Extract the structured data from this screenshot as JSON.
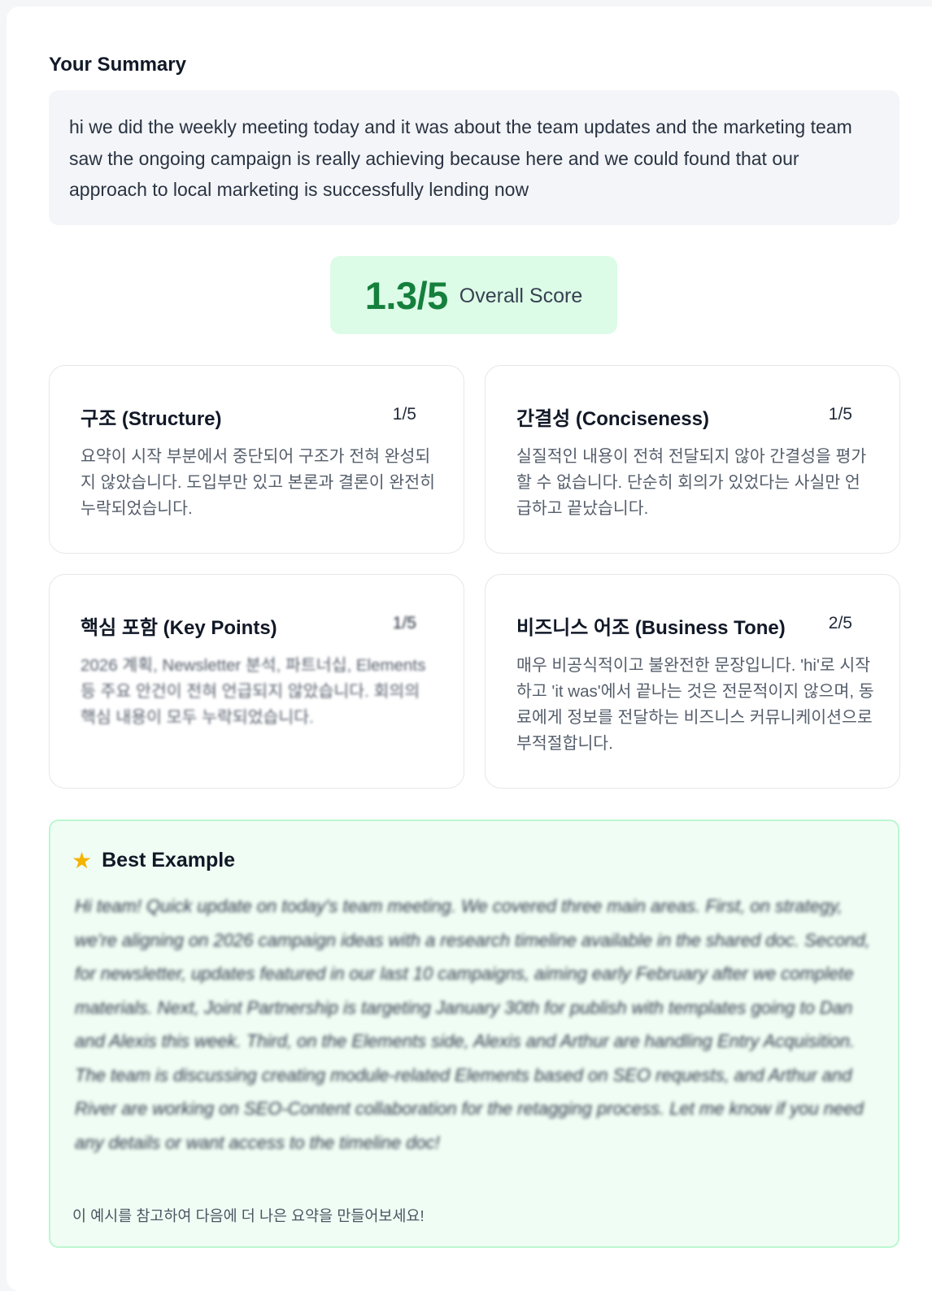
{
  "summary": {
    "label": "Your Summary",
    "text": "hi we did the weekly meeting today and it was  about the team updates and the marketing team saw the ongoing campaign is really achieving because here and we could found that our approach to local marketing is successfully lending now"
  },
  "score": {
    "value": "1.3/5",
    "label": "Overall Score"
  },
  "criteria": [
    {
      "title": "구조 (Structure)",
      "score": "1/5",
      "feedback": "요약이 시작 부분에서 중단되어 구조가 전혀 완성되지 않았습니다. 도입부만 있고 본론과 결론이 완전히 누락되었습니다."
    },
    {
      "title": "간결성 (Conciseness)",
      "score": "1/5",
      "feedback": "실질적인 내용이 전혀 전달되지 않아 간결성을 평가할 수 없습니다. 단순히 회의가 있었다는 사실만 언급하고 끝났습니다."
    },
    {
      "title": "핵심 포함 (Key Points)",
      "score": "1/5",
      "feedback": "2026 계획, Newsletter 분석, 파트너십, Elements 등 주요 안건이 전혀 언급되지 않았습니다. 회의의 핵심 내용이 모두 누락되었습니다."
    },
    {
      "title": "비즈니스 어조 (Business Tone)",
      "score": "2/5",
      "feedback": "매우 비공식적이고 불완전한 문장입니다. 'hi'로 시작하고 'it was'에서 끝나는 것은 전문적이지 않으며, 동료에게 정보를 전달하는 비즈니스 커뮤니케이션으로 부적절합니다."
    }
  ],
  "best_example": {
    "icon": "star-icon",
    "title": "Best Example",
    "text": "Hi team! Quick update on today's team meeting. We covered three main areas. First, on strategy, we're aligning on 2026 campaign ideas with a research timeline available in the shared doc. Second, for newsletter, updates featured in our last 10 campaigns, aiming early February after we complete materials. Next, Joint Partnership is targeting January 30th for publish with templates going to Dan and Alexis this week. Third, on the Elements side, Alexis and Arthur are handling Entry Acquisition. The team is discussing creating module-related Elements based on SEO requests, and Arthur and River are working on SEO-Content collaboration for the retagging process. Let me know if you need any details or want access to the timeline doc!",
    "hint": "이 예시를 참고하여 다음에 더 나은 요약을 만들어보세요!"
  },
  "colors": {
    "score_bg": "#dcfce7",
    "score_text": "#15803d",
    "best_bg": "#f0fdf4",
    "best_border": "#bbf7d0"
  }
}
